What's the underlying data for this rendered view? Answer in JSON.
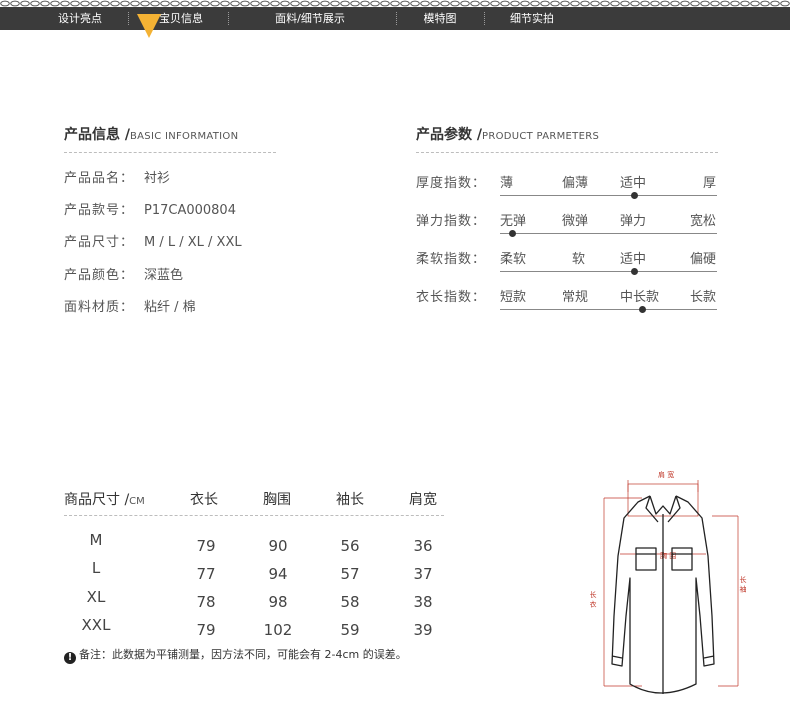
{
  "nav": {
    "items": [
      "设计亮点",
      "宝贝信息",
      "面料/细节展示",
      "模特图",
      "细节实拍"
    ],
    "active_index": 1
  },
  "info": {
    "title": "产品信息 /",
    "subtitle": "BASIC INFORMATION",
    "rows": [
      {
        "label": "产品品名：",
        "value": "衬衫"
      },
      {
        "label": "产品款号：",
        "value": "P17CA000804"
      },
      {
        "label": "产品尺寸：",
        "value": "M / L / XL / XXL"
      },
      {
        "label": "产品颜色：",
        "value": "深蓝色"
      },
      {
        "label": "面料材质：",
        "value": "粘纤 / 棉"
      }
    ]
  },
  "params": {
    "title": "产品参数 /",
    "subtitle": "PRODUCT PARMETERS",
    "rows": [
      {
        "label": "厚度指数：",
        "options": [
          "薄",
          "偏薄",
          "适中",
          "厚"
        ],
        "selected": 2
      },
      {
        "label": "弹力指数：",
        "options": [
          "无弹",
          "微弹",
          "弹力",
          "宽松"
        ],
        "selected": 0
      },
      {
        "label": "柔软指数：",
        "options": [
          "柔软",
          "软",
          "适中",
          "偏硬"
        ],
        "selected": 2
      },
      {
        "label": "衣长指数：",
        "options": [
          "短款",
          "常规",
          "中长款",
          "长款"
        ],
        "selected": 2
      }
    ]
  },
  "size_table": {
    "header_label": "商品尺寸 /",
    "header_unit": "CM",
    "columns": [
      "衣长",
      "胸围",
      "袖长",
      "肩宽"
    ],
    "rows": [
      {
        "size": "M",
        "values": [
          "79",
          "90",
          "56",
          "36"
        ]
      },
      {
        "size": "L",
        "values": [
          "77",
          "94",
          "57",
          "37"
        ]
      },
      {
        "size": "XL",
        "values": [
          "78",
          "98",
          "58",
          "38"
        ]
      },
      {
        "size": "XXL",
        "values": [
          "79",
          "102",
          "59",
          "39"
        ]
      }
    ],
    "note_icon": "!",
    "note": "备注：此数据为平铺测量，因方法不同，可能会有 2-4cm 的误差。"
  },
  "diagram": {
    "labels": {
      "shoulder": "肩 宽",
      "chest": "胸 围",
      "length": "长 衣",
      "sleeve": "长 袖"
    },
    "accent_color": "#c0392b"
  }
}
